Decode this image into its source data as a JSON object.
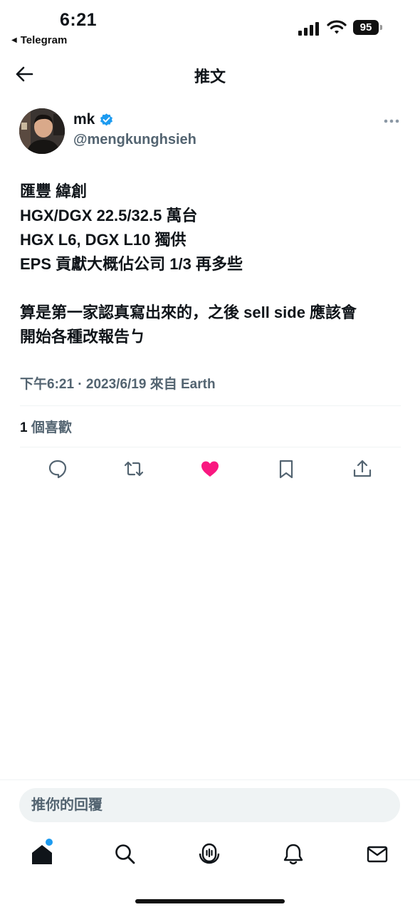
{
  "status_bar": {
    "time": "6:21",
    "back_app": "Telegram",
    "battery": "95"
  },
  "header": {
    "title": "推文",
    "back_icon": "arrow-left-icon"
  },
  "author": {
    "name": "mk",
    "handle": "@mengkunghsieh",
    "verified": true,
    "verified_color": "#1d9bf0"
  },
  "tweet": {
    "lines": [
      "匯豐 緯創",
      "HGX/DGX 22.5/32.5 萬台",
      "HGX L6, DGX L10 獨供",
      "EPS 貢獻大概佔公司 1/3 再多些",
      "",
      "算是第一家認真寫出來的，之後 sell side 應該會",
      "開始各種改報告ㄅ"
    ],
    "meta": "下午6:21 · 2023/6/19 來自 Earth",
    "likes_count": "1",
    "likes_label": "個喜歡"
  },
  "actions": [
    {
      "icon": "reply-icon"
    },
    {
      "icon": "retweet-icon"
    },
    {
      "icon": "heart-icon",
      "active": true,
      "color": "#f91880"
    },
    {
      "icon": "bookmark-icon"
    },
    {
      "icon": "share-icon"
    }
  ],
  "reply": {
    "placeholder": "推你的回覆"
  },
  "tabbar": [
    {
      "icon": "home-icon",
      "badge": true
    },
    {
      "icon": "search-icon"
    },
    {
      "icon": "spaces-icon"
    },
    {
      "icon": "notifications-icon"
    },
    {
      "icon": "messages-icon"
    }
  ],
  "colors": {
    "accent": "#1d9bf0",
    "like": "#f91880",
    "secondary_text": "#536471"
  }
}
